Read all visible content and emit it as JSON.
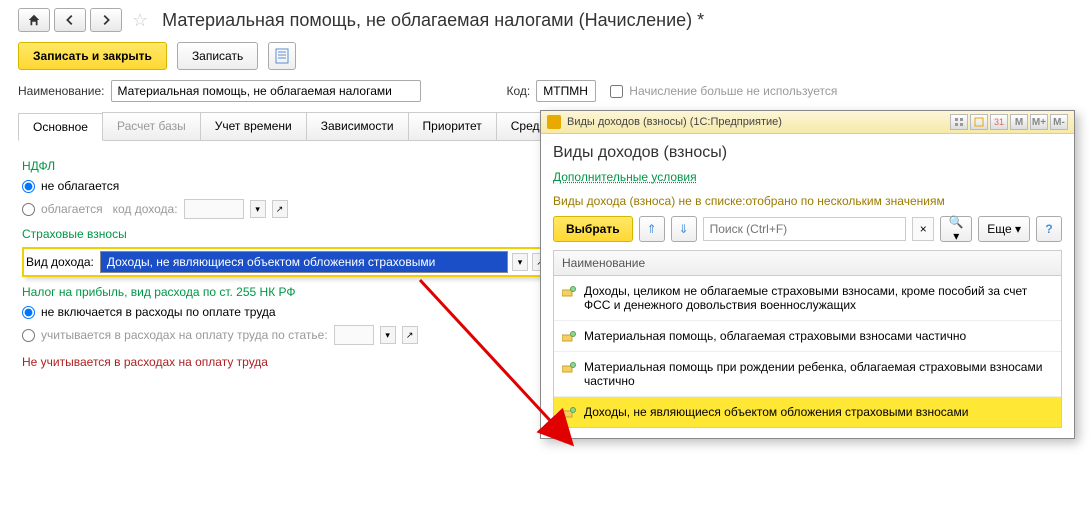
{
  "header": {
    "title": "Материальная помощь, не облагаемая налогами (Начисление) *"
  },
  "actions": {
    "save_close": "Записать и закрыть",
    "save": "Записать"
  },
  "name_row": {
    "label": "Наименование:",
    "value": "Материальная помощь, не облагаемая налогами",
    "code_label": "Код:",
    "code_value": "МТПМН",
    "nolonger_label": "Начисление больше не используется"
  },
  "tabs": [
    "Основное",
    "Расчет базы",
    "Учет времени",
    "Зависимости",
    "Приоритет",
    "Средн"
  ],
  "ndfl": {
    "title": "НДФЛ",
    "opt1": "не облагается",
    "opt2": "облагается",
    "code_label": "код дохода:"
  },
  "sv": {
    "title": "Страховые взносы",
    "vd_label": "Вид дохода:",
    "vd_value": "Доходы, не являющиеся объектом обложения страховыми"
  },
  "np": {
    "title": "Налог на прибыль, вид расхода по ст. 255 НК РФ",
    "opt1": "не включается в расходы по оплате труда",
    "opt2": "учитывается в расходах на оплату труда по статье:",
    "note": "Не учитывается в расходах на оплату труда"
  },
  "popup": {
    "titlebar": "Виды доходов (взносы) (1С:Предприятие)",
    "title": "Виды доходов (взносы)",
    "link": "Дополнительные условия",
    "filter": "Виды дохода (взноса) не в списке:отобрано по нескольким значениям",
    "select_btn": "Выбрать",
    "search_placeholder": "Поиск (Ctrl+F)",
    "more_btn": "Еще",
    "list_header": "Наименование",
    "items": [
      "Доходы, целиком не облагаемые страховыми взносами, кроме пособий за счет ФСС и денежного довольствия военнослужащих",
      "Материальная помощь, облагаемая страховыми взносами частично",
      "Материальная помощь при рождении ребенка, облагаемая страховыми взносами частично",
      "Доходы, не являющиеся объектом обложения страховыми взносами"
    ]
  }
}
